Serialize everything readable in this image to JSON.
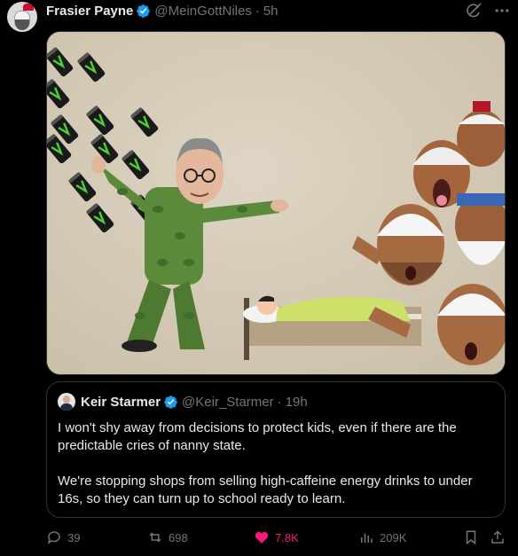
{
  "tweet": {
    "author": {
      "display_name": "Frasier Payne",
      "handle": "@MeinGottNiles",
      "verified": true
    },
    "time": "5h",
    "separator": "·",
    "media_icon_names": [
      "energy-drink-can-icon"
    ],
    "quoted": {
      "author": {
        "display_name": "Keir Starmer",
        "handle": "@Keir_Starmer",
        "verified": true
      },
      "time": "19h",
      "separator": "·",
      "text": "I won't shy away from decisions to protect kids, even if there are the predictable cries of nanny state.\n\nWe're stopping shops from selling high-caffeine energy drinks to under 16s, so they can turn up to school ready to learn."
    },
    "actions": {
      "replies": "39",
      "reposts": "698",
      "likes": "7.8K",
      "views": "209K"
    }
  },
  "colors": {
    "background": "#000000",
    "text_primary": "#e7e9ea",
    "text_secondary": "#71767b",
    "verified": "#1d9bf0",
    "like_active": "#f91880",
    "border": "#2f3336"
  }
}
